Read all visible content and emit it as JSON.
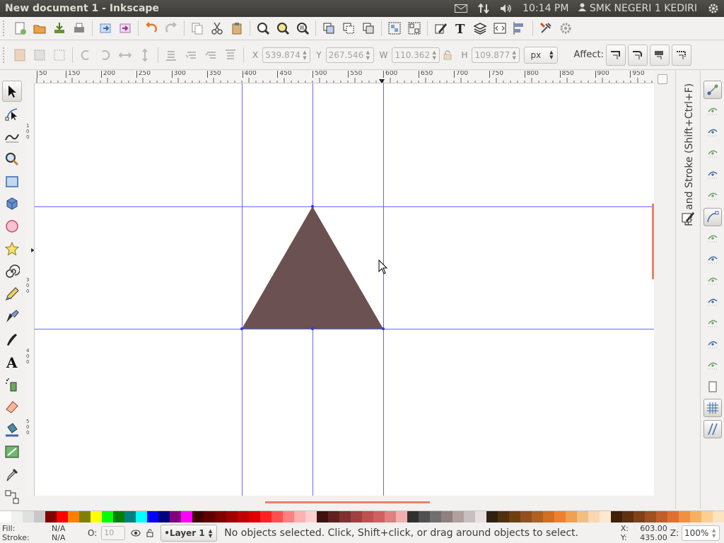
{
  "window": {
    "title": "New document 1 - Inkscape"
  },
  "tray": {
    "icons": [
      "mail-icon",
      "network-icon",
      "volume-icon"
    ],
    "clock": "10:14 PM",
    "user": "SMK NEGERI 1 KEDIRI",
    "settings_icon": "gear-icon"
  },
  "commands": [
    "new-document-icon",
    "open-icon",
    "save-icon",
    "print-icon",
    "|",
    "import-icon",
    "export-icon",
    "|",
    "undo-icon",
    "redo-icon",
    "|",
    "copy-icon",
    "cut-icon",
    "paste-icon",
    "|",
    "zoom-selection-icon",
    "zoom-drawing-icon",
    "zoom-page-icon",
    "|",
    "duplicate-icon",
    "clone-icon",
    "unlink-clone-icon",
    "|",
    "group-icon",
    "ungroup-icon",
    "|",
    "fill-stroke-icon",
    "text-font-icon",
    "layers-icon",
    "xml-editor-icon",
    "align-distribute-icon",
    "|",
    "preferences-icon",
    "document-properties-icon"
  ],
  "select_toolbar": {
    "x_label": "X",
    "x_value": "539.874",
    "y_label": "Y",
    "y_value": "267.546",
    "w_label": "W",
    "w_value": "110.362",
    "h_label": "H",
    "h_value": "109.877",
    "unit": "px",
    "affect_label": "Affect:"
  },
  "tools": [
    "selector-tool-icon",
    "node-tool-icon",
    "tweak-tool-icon",
    "zoom-tool-icon",
    "rectangle-tool-icon",
    "box-3d-tool-icon",
    "ellipse-tool-icon",
    "star-tool-icon",
    "spiral-tool-icon",
    "pencil-tool-icon",
    "pen-tool-icon",
    "calligraphy-tool-icon",
    "text-tool-icon",
    "spray-tool-icon",
    "eraser-tool-icon",
    "paint-bucket-tool-icon",
    "gradient-tool-icon",
    "dropper-tool-icon",
    "connector-tool-icon"
  ],
  "ruler": {
    "h_labels": [
      "50",
      "150",
      "200",
      "250",
      "300",
      "350",
      "400",
      "450",
      "500",
      "550",
      "600",
      "650",
      "700",
      "750",
      "800",
      "850",
      "900",
      "950"
    ]
  },
  "canvas": {
    "triangle_color": "#6b5151",
    "guide_color": "#3333ff"
  },
  "dock": {
    "title": "Fill and Stroke (Shift+Ctrl+F)"
  },
  "snap_controls": [
    "snap-enable-icon",
    "snap-bbox-icon",
    "snap-bbox-edge-icon",
    "snap-bbox-corner-icon",
    "snap-bbox-midpoint-icon",
    "snap-bbox-center-icon",
    "snap-nodes-icon",
    "snap-path-icon",
    "snap-intersection-icon",
    "snap-cusp-icon",
    "snap-smooth-icon",
    "snap-line-midpoint-icon",
    "snap-object-center-icon",
    "snap-rotation-center-icon",
    "snap-page-icon",
    "snap-grid-icon",
    "snap-guide-icon"
  ],
  "palette": {
    "colors": [
      "#ffffff",
      "#f0f0f0",
      "#e0e0e0",
      "#c8c8c8",
      "#800000",
      "#ff0000",
      "#ff8000",
      "#808000",
      "#ffff00",
      "#00ff00",
      "#008000",
      "#008080",
      "#00ffff",
      "#0000ff",
      "#000080",
      "#800080",
      "#ff00ff",
      "#400000",
      "#600000",
      "#800000",
      "#a00000",
      "#c00000",
      "#e00000",
      "#ff2020",
      "#ff5050",
      "#ff8080",
      "#ffb0b0",
      "#ffd0d0",
      "#401010",
      "#602020",
      "#803030",
      "#a04040",
      "#c05050",
      "#d06060",
      "#e08080",
      "#f0b0b0",
      "#303030",
      "#505050",
      "#707070",
      "#908080",
      "#b0a0a0",
      "#c8c0c0",
      "#e8e0e0",
      "#302010",
      "#503010",
      "#704010",
      "#905020",
      "#b06020",
      "#d07020",
      "#f08030",
      "#f0a050",
      "#f0c080",
      "#f8d8b0",
      "#fbe8d0",
      "#402008",
      "#603010",
      "#804018",
      "#a05020",
      "#c06028",
      "#e07030",
      "#f09040",
      "#f8b060",
      "#fcd090",
      "#fde4c0"
    ]
  },
  "status": {
    "fill_label": "Fill:",
    "fill_value": "N/A",
    "stroke_label": "Stroke:",
    "stroke_value": "N/A",
    "opacity_label": "O:",
    "opacity_value": "10",
    "layer": "•Layer 1",
    "message": "No objects selected. Click, Shift+click, or drag around objects to select.",
    "x_label": "X:",
    "x_value": "603.00",
    "y_label": "Y:",
    "y_value": "435.00",
    "zoom_label": "Z:",
    "zoom_value": "100%"
  }
}
